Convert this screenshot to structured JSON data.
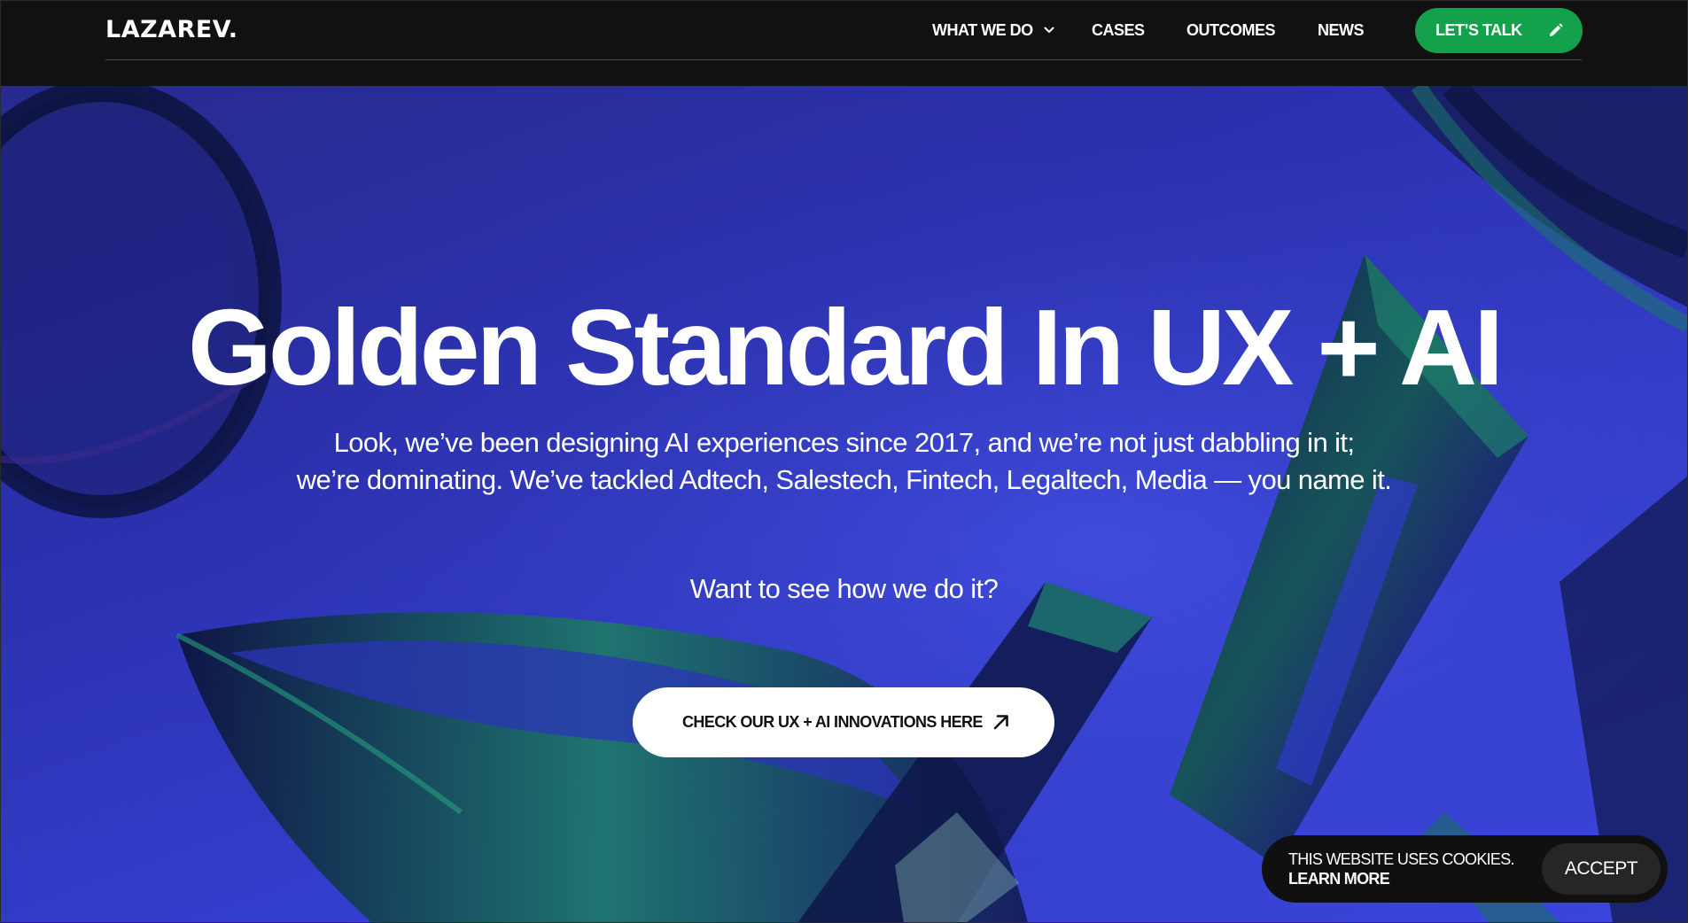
{
  "header": {
    "logo": "LAZAREV.",
    "nav": {
      "what_we_do": "WHAT WE DO",
      "cases": "CASES",
      "outcomes": "OUTCOMES",
      "news": "NEWS"
    },
    "cta_label": "LET’S TALK",
    "cta_icon": "pencil-icon"
  },
  "hero": {
    "headline": "Golden Standard In UX + AI",
    "subtext_line1": "Look, we’ve been designing AI experiences since 2017, and we’re not just dabbling in it;",
    "subtext_line2": "we’re dominating. We’ve tackled Adtech, Salestech, Fintech, Legaltech, Media — you name it.",
    "question": "Want to see how we do it?",
    "cta_label": "CHECK OUR UX + AI INNOVATIONS HERE",
    "cta_icon": "arrow-up-right-icon"
  },
  "cookie_banner": {
    "message": "THIS WEBSITE USES COOKIES.",
    "learn_more": "LEARN MORE",
    "accept": "ACCEPT"
  },
  "colors": {
    "header_bg": "#111111",
    "accent_green": "#13a24b",
    "hero_blue": "#2b31b0",
    "text_white": "#ffffff"
  }
}
